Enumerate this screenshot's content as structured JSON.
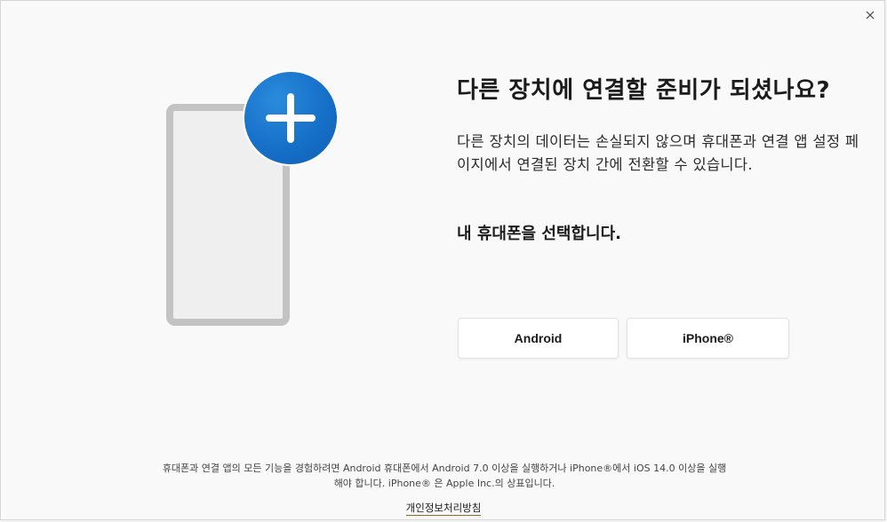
{
  "dialog": {
    "close_label": "×"
  },
  "header": {
    "title": "다른 장치에 연결할 준비가 되셨나요?",
    "description": "다른 장치의 데이터는 손실되지 않으며 휴대폰과 연결 앱 설정 페이지에서 연결된 장치 간에 전환할 수 있습니다."
  },
  "selection": {
    "prompt": "내 휴대폰을 선택합니다.",
    "options": [
      {
        "label": "Android"
      },
      {
        "label": "iPhone®"
      }
    ]
  },
  "footer": {
    "note_line1": "휴대폰과 연결 앱의 모든 기능을 경험하려면 Android 휴대폰에서 Android 7.0 이상을 실행하거나 iPhone®에서 iOS 14.0 이상을 실행",
    "note_line2": "해야 합니다. iPhone® 은 Apple Inc.의 상표입니다.",
    "privacy_link": "개인정보처리방침"
  },
  "colors": {
    "accent": "#1670c8",
    "phone_frame": "#c3c3c3",
    "link_underline": "#8a6c2b"
  },
  "icons": {
    "close": "close-icon",
    "plus": "plus-icon",
    "phone": "phone-icon"
  }
}
